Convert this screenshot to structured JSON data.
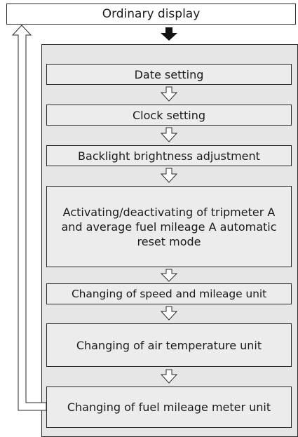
{
  "diagram": {
    "top_label": "Ordinary display",
    "steps": [
      {
        "label": "Date setting"
      },
      {
        "label": "Clock setting"
      },
      {
        "label": "Backlight brightness adjustment"
      },
      {
        "label": "Activating/deactivating of tripmeter A and average fuel mileage A automatic reset mode"
      },
      {
        "label": "Changing of speed and mileage unit"
      },
      {
        "label": "Changing of air temperature unit"
      },
      {
        "label": "Changing of fuel mileage meter unit"
      }
    ]
  },
  "colors": {
    "box_fill": "#ececec",
    "panel_fill": "#e6e6e6",
    "border": "#2a2a2a",
    "arrow_fill": "#111111"
  },
  "icons": [
    "down-arrow-solid-icon",
    "down-arrow-outline-icon",
    "return-arrow-icon"
  ]
}
